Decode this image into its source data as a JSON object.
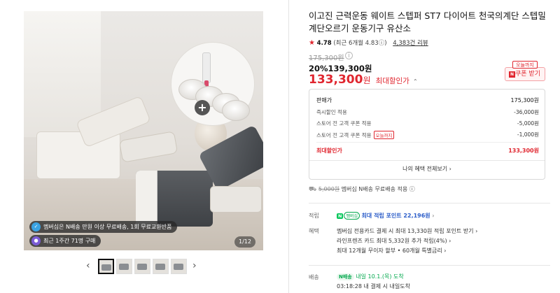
{
  "gallery": {
    "badge1_text": "멤버십은 N배송 만원 이상 무료배송, 1회 무료교환반품",
    "badge2_text": "최근 1주간 71명 구매",
    "badge1_icon": "tag-icon",
    "badge2_icon": "person-icon",
    "counter": "1/12",
    "prev_arrow": "‹",
    "next_arrow": "›",
    "thumbnail_count": 5
  },
  "product": {
    "title": "이고진 근력운동 웨이트 스텝퍼 ST7 다이어트 천국의계단 스텝밀 계단오르기 운동기구 유산소",
    "rating": {
      "star": "★",
      "score": "4.78",
      "detail": "(최근 6개월 4.83ⓘ)",
      "reviews": "4,383건 리뷰"
    },
    "original_price": "175,300원",
    "discount": "20%139,300원",
    "final_price": "133,300",
    "final_won": "원",
    "final_label": "최대할인가",
    "final_caret": "⌃",
    "coupon_tag": "오늘까지",
    "coupon_button": "쿠폰 받기",
    "coupon_icon_text": "N"
  },
  "breakdown": {
    "rows": [
      {
        "label": "판매가",
        "value": "175,300원"
      },
      {
        "label": "즉시할인 적용",
        "value": "-36,000원"
      },
      {
        "label": "스토어 전 고객 쿠폰 적용",
        "value": "-5,000원"
      },
      {
        "label": "스토어 전 고객 쿠폰 적용",
        "tag": "오늘까지",
        "value": "-1,000원"
      },
      {
        "label": "최대할인가",
        "value": "133,300원"
      }
    ],
    "footer": "나의 혜택 전체보기 ›"
  },
  "shipping_line": {
    "fee": "5,000원",
    "text": " 멤버십 N배송 무료배송 적용 ⓘ"
  },
  "points": {
    "label": "적립",
    "npay": "N",
    "membership": "멤버십",
    "text": "최대 적립 포인트 22,196원",
    "chevron": "›"
  },
  "benefits": {
    "label": "혜택",
    "line1": "멤버십 전용카드 결제 시 최대 13,330원 적립 포인트 받기 ›",
    "line2": "라인프렌즈 카드 최대 5,332원 추가 적립(4%) ›",
    "line3": "최대 12개월 무이자 할부 • 60개월 특별금리 ›"
  },
  "delivery": {
    "label": "배송",
    "badge": "N배송",
    "arrival": "내일 10.1.(목) 도착",
    "sub": "03:18:28 내 결제 시 내일도착"
  },
  "colors": {
    "accent_red": "#e0262f",
    "npay_green": "#03c75a",
    "link_blue": "#2d5ec9"
  }
}
